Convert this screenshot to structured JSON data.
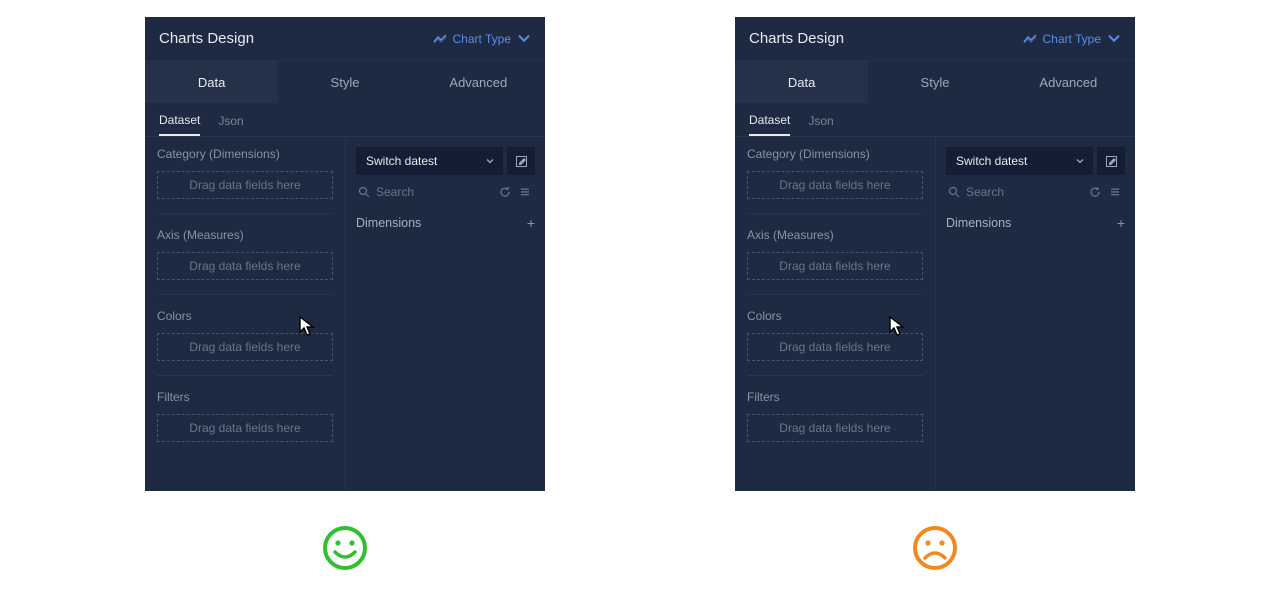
{
  "header": {
    "title": "Charts Design",
    "chart_type_label": "Chart Type"
  },
  "tabs_main": [
    "Data",
    "Style",
    "Advanced"
  ],
  "tabs_main_active": 0,
  "tabs_sub": [
    "Dataset",
    "Json"
  ],
  "tabs_sub_active": 0,
  "left_sections": [
    {
      "label": "Category (Dimensions)",
      "placeholder": "Drag data fields here"
    },
    {
      "label": "Axis (Measures)",
      "placeholder": "Drag data fields here"
    },
    {
      "label": "Colors",
      "placeholder": "Drag data fields here"
    },
    {
      "label": "Filters",
      "placeholder": "Drag data fields here"
    }
  ],
  "right": {
    "select_label": "Switch datest",
    "search_placeholder": "Search",
    "dimensions_label": "Dimensions"
  },
  "faces": {
    "good_color": "#2fbf2f",
    "bad_color": "#f08a1f"
  }
}
